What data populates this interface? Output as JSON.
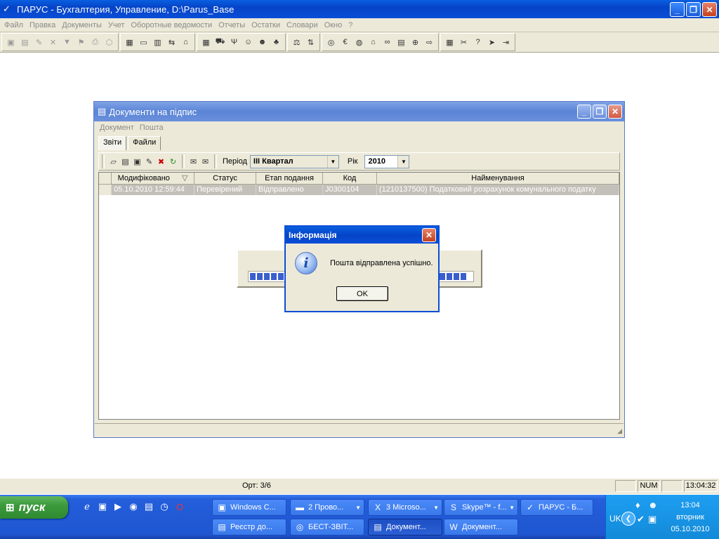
{
  "app": {
    "title": "ПАРУС - Бухгалтерия, Управление, D:\\Parus_Base",
    "window_controls": [
      "_",
      "❐",
      "✕"
    ]
  },
  "menu": [
    "Файл",
    "Правка",
    "Документы",
    "Учет",
    "Оборотные ведомости",
    "Отчеты",
    "Остатки",
    "Словари",
    "Окно",
    "?"
  ],
  "child_window": {
    "title": "Документи на підпис",
    "menu": [
      "Документ",
      "Пошта"
    ],
    "tabs": [
      "Звіти",
      "Файли"
    ],
    "toolbar": {
      "period_label": "Період",
      "period_value": "III Квартал",
      "year_label": "Рік",
      "year_value": "2010"
    },
    "grid": {
      "columns": [
        "Модифіковано",
        "Статус",
        "Етап подання",
        "Код",
        "Найменування"
      ],
      "sort_indicator": "▽",
      "rows": [
        [
          "05.10.2010 12:59:44",
          "Перевірений",
          "Відправлено",
          "J0300104",
          "(1210137500)  Податковий розрахунок комунального податку"
        ]
      ]
    }
  },
  "dialog": {
    "title": "Інформація",
    "message": "Пошта відправлена успішно.",
    "ok_label": "OK"
  },
  "statusbar": {
    "text": "Орт: 3/6",
    "num": "NUM",
    "time": "13:04:32"
  },
  "taskbar": {
    "start_label": "пуск",
    "tasks_row1": [
      {
        "label": "Windows C...",
        "icon": "window-icon"
      },
      {
        "label": "2 Прово...",
        "icon": "folder-icon",
        "dropdown": true
      },
      {
        "label": "3 Microso...",
        "icon": "excel-icon",
        "dropdown": true
      },
      {
        "label": "Skype™ - f...",
        "icon": "skype-icon",
        "dropdown": true
      },
      {
        "label": "ПАРУС - Б...",
        "icon": "parus-icon"
      }
    ],
    "tasks_row2": [
      {
        "label": "Реєстр до...",
        "icon": "document-icon"
      },
      {
        "label": "БЕСТ-ЗВІТ...",
        "icon": "best-icon"
      },
      {
        "label": "Документ...",
        "icon": "document-icon",
        "active": true
      },
      {
        "label": "Документ...",
        "icon": "word-icon"
      }
    ],
    "tray": {
      "lang": "UK",
      "time": "13:04",
      "day": "вторник",
      "date": "05.10.2010"
    }
  }
}
